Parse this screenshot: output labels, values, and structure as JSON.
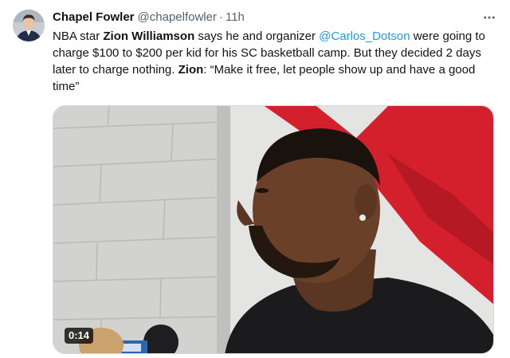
{
  "author": {
    "display_name": "Chapel Fowler",
    "handle": "@chapelfowler",
    "separator": "·",
    "time": "11h",
    "avatar_icon": "profile-photo"
  },
  "menu": {
    "more_icon": "more-horizontal-icon"
  },
  "tweet": {
    "t1": "NBA star ",
    "name1": "Zion Williamson",
    "t2": " says he and organizer ",
    "mention": "@Carlos_Dotson",
    "t3": " were going to charge $100 to $200 per kid for his SC basketball camp. But they decided 2 days later to charge nothing. ",
    "name2": "Zion",
    "t4": ": “Make it free, let people show up and have a good time”"
  },
  "media": {
    "type": "video",
    "duration": "0:14"
  },
  "colors": {
    "text": "#0f1419",
    "secondary": "#536471",
    "link": "#1d9bf0",
    "wall_red": "#d4202c"
  }
}
